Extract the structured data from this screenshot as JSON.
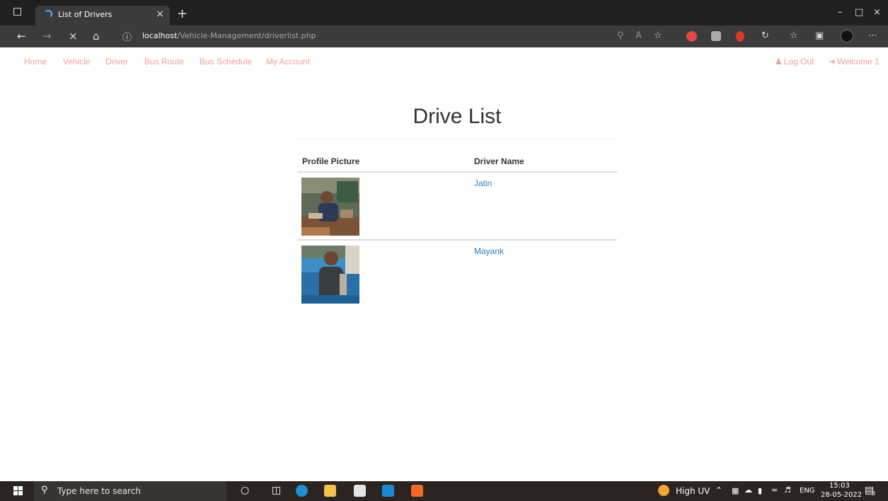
{
  "browser": {
    "tab_title": "List of Drivers",
    "url_host": "localhost",
    "url_path": "/Vehicle-Management/driverlist.php"
  },
  "navbar": {
    "links": [
      "Home",
      "Vehicle",
      "Driver",
      "Bus Route",
      "Bus Schedule",
      "My Account"
    ],
    "logout": "Log Out",
    "welcome": "Welcome 1",
    "link_color": "#f0a0a0"
  },
  "main": {
    "title": "Drive List",
    "columns": [
      "Profile Picture",
      "Driver Name"
    ],
    "drivers": [
      {
        "name": "Jatin"
      },
      {
        "name": "Mayank"
      }
    ],
    "link_color": "#337ab7"
  },
  "taskbar": {
    "search_placeholder": "Type here to search",
    "weather": "High UV",
    "language": "ENG",
    "time": "15:03",
    "date": "28-05-2022",
    "notification_count": "3"
  }
}
